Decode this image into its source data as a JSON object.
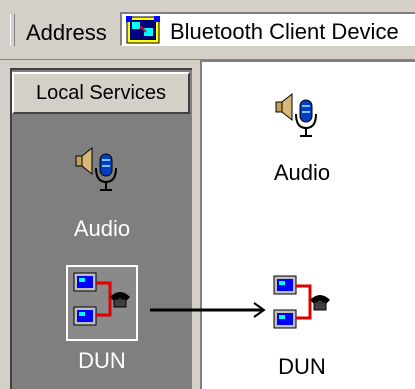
{
  "addressbar": {
    "label": "Address",
    "value": "Bluetooth Client Device",
    "icon": "bluetooth-folder-icon"
  },
  "left_pane": {
    "header": "Local Services",
    "items": [
      {
        "label": "Audio",
        "icon": "audio-speaker-mic-icon"
      },
      {
        "label": "DUN",
        "icon": "dial-up-network-icon",
        "selected": true
      }
    ]
  },
  "right_pane": {
    "items": [
      {
        "label": "Audio",
        "icon": "audio-speaker-mic-icon"
      },
      {
        "label": "DUN",
        "icon": "dial-up-network-icon"
      }
    ]
  },
  "colors": {
    "pane_dark": "#7f7f7f",
    "chrome": "#d4d0c8",
    "cable_red": "#e00000",
    "monitor_blue": "#0000ff"
  }
}
